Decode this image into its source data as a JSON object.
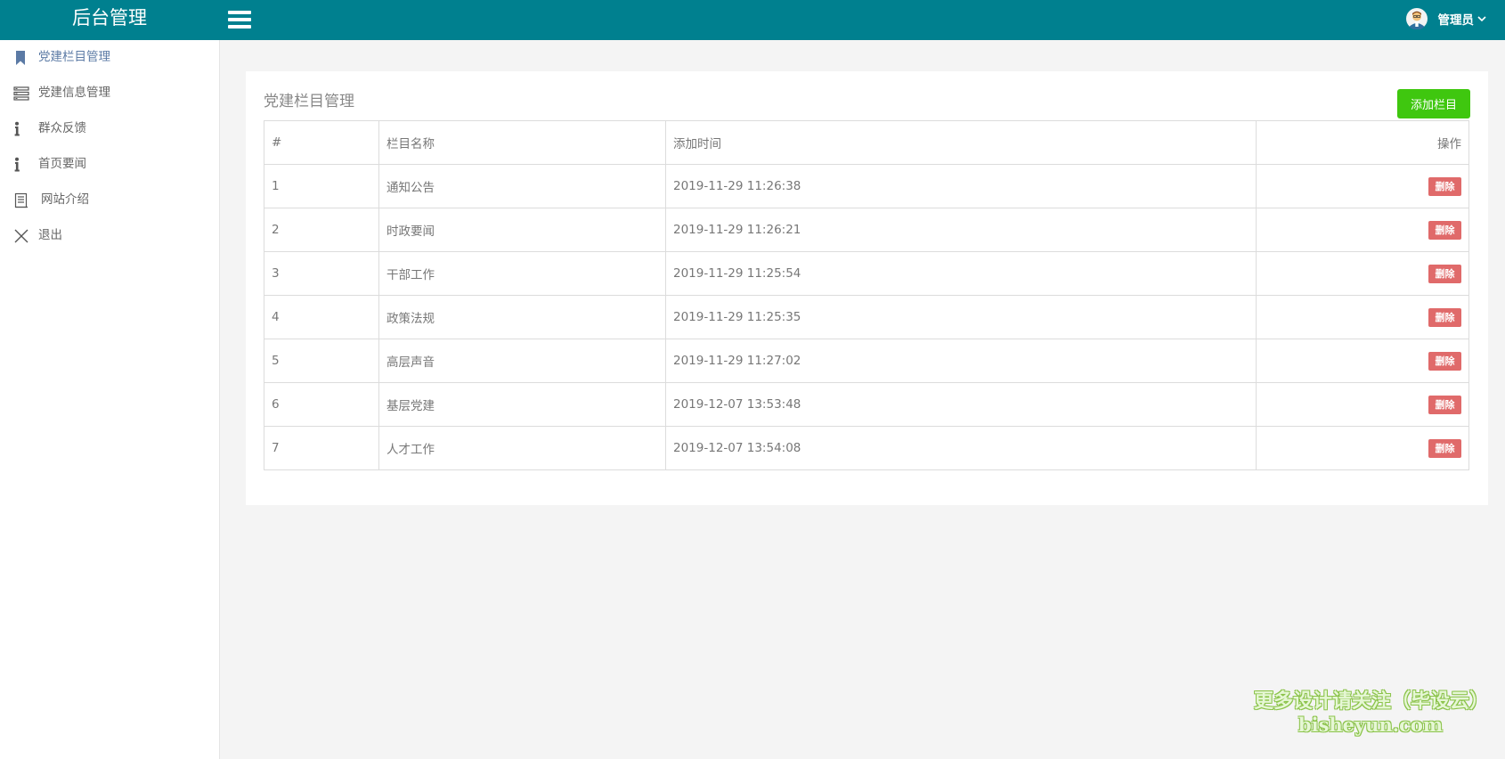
{
  "brand": {
    "title": "后台管理"
  },
  "header": {
    "user_name": "管理员"
  },
  "sidebar": {
    "items": [
      {
        "label": "党建栏目管理",
        "icon": "bookmark-icon"
      },
      {
        "label": "党建信息管理",
        "icon": "list-icon"
      },
      {
        "label": "群众反馈",
        "icon": "info-icon"
      },
      {
        "label": "首页要闻",
        "icon": "info-icon"
      },
      {
        "label": "网站介绍",
        "icon": "document-icon"
      },
      {
        "label": "退出",
        "icon": "close-icon"
      }
    ]
  },
  "main": {
    "title": "党建栏目管理",
    "add_button": "添加栏目",
    "table": {
      "headers": [
        "#",
        "栏目名称",
        "添加时间",
        "操作"
      ],
      "rows": [
        {
          "id": "1",
          "name": "通知公告",
          "time": "2019-11-29 11:26:38",
          "action": "删除"
        },
        {
          "id": "2",
          "name": "时政要闻",
          "time": "2019-11-29 11:26:21",
          "action": "删除"
        },
        {
          "id": "3",
          "name": "干部工作",
          "time": "2019-11-29 11:25:54",
          "action": "删除"
        },
        {
          "id": "4",
          "name": "政策法规",
          "time": "2019-11-29 11:25:35",
          "action": "删除"
        },
        {
          "id": "5",
          "name": "高层声音",
          "time": "2019-11-29 11:27:02",
          "action": "删除"
        },
        {
          "id": "6",
          "name": "基层党建",
          "time": "2019-12-07 13:53:48",
          "action": "删除"
        },
        {
          "id": "7",
          "name": "人才工作",
          "time": "2019-12-07 13:54:08",
          "action": "删除"
        }
      ]
    }
  },
  "watermark": {
    "line1": "更多设计请关注（毕设云）",
    "line2": "bisheyun.com"
  },
  "colors": {
    "header_bg": "#00808f",
    "add_button": "#3fc70f",
    "delete_button": "#e06a6a",
    "active_nav": "#5b7aa5"
  }
}
